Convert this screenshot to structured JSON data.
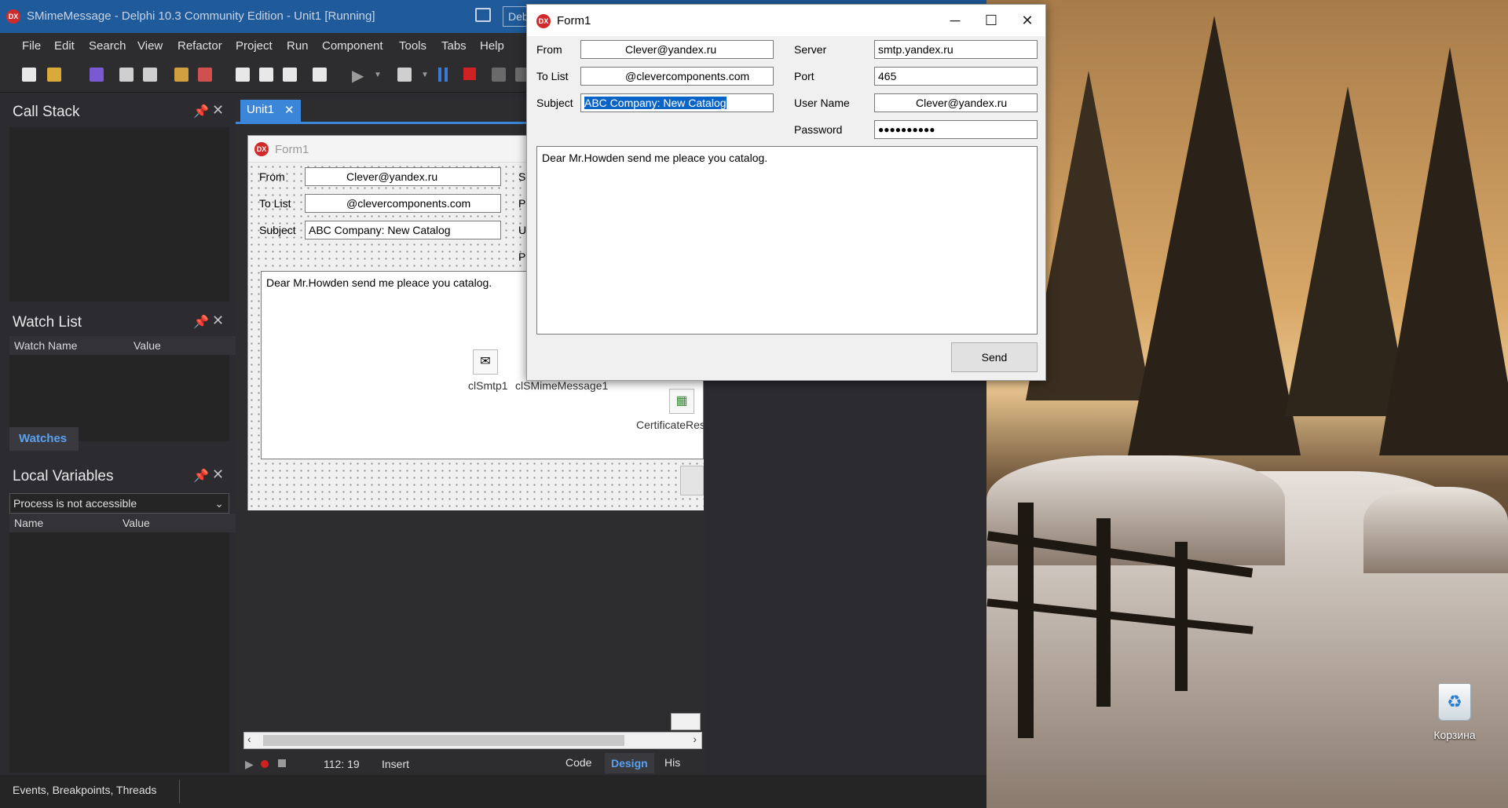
{
  "ide": {
    "title": "SMimeMessage - Delphi 10.3 Community Edition - Unit1 [Running]",
    "app_icon": "DX",
    "menu": [
      "File",
      "Edit",
      "Search",
      "View",
      "Refactor",
      "Project",
      "Run",
      "Component",
      "Tools",
      "Tabs",
      "Help"
    ],
    "debug_badge": "Deb"
  },
  "docks": {
    "call_stack": {
      "title": "Call Stack"
    },
    "watch_list": {
      "title": "Watch List",
      "columns": [
        "Watch Name",
        "Value"
      ],
      "tab": "Watches"
    },
    "local_variables": {
      "title": "Local Variables",
      "process": "Process is not accessible",
      "columns": [
        "Name",
        "Value"
      ]
    }
  },
  "editor": {
    "tab": "Unit1",
    "design_form": {
      "caption": "Form1",
      "labels": {
        "from": "From",
        "to": "To List",
        "subject": "Subject",
        "se": "Se",
        "po": "Po",
        "us": "Us",
        "pa": "Pa"
      },
      "from": "Clever@yandex.ru",
      "to": "@clevercomponents.com",
      "subject": "ABC Company: New Catalog",
      "body": "Dear Mr.Howden send me pleace you catalog.",
      "components": [
        "clSmtp1",
        "clSMimeMessage1",
        "CertificateRes"
      ]
    },
    "position": "112: 19",
    "mode": "Insert",
    "view_tabs": [
      "Code",
      "Design",
      "His"
    ]
  },
  "form1": {
    "caption": "Form1",
    "labels": {
      "from": "From",
      "to": "To List",
      "subject": "Subject",
      "server": "Server",
      "port": "Port",
      "username": "User Name",
      "password": "Password"
    },
    "from": "Clever@yandex.ru",
    "to": "@clevercomponents.com",
    "subject": "ABC Company: New Catalog",
    "server": "smtp.yandex.ru",
    "port": "465",
    "username": "Clever@yandex.ru",
    "password": "●●●●●●●●●●",
    "body": "Dear Mr.Howden send me pleace you catalog.",
    "send_label": "Send"
  },
  "statusbar": {
    "text": "Events, Breakpoints, Threads"
  },
  "desktop": {
    "recycle_bin_label": "Корзина"
  },
  "colors": {
    "ide_title": "#1f5a9a",
    "selection": "#0a64c8",
    "tab_active": "#3b86d8"
  }
}
